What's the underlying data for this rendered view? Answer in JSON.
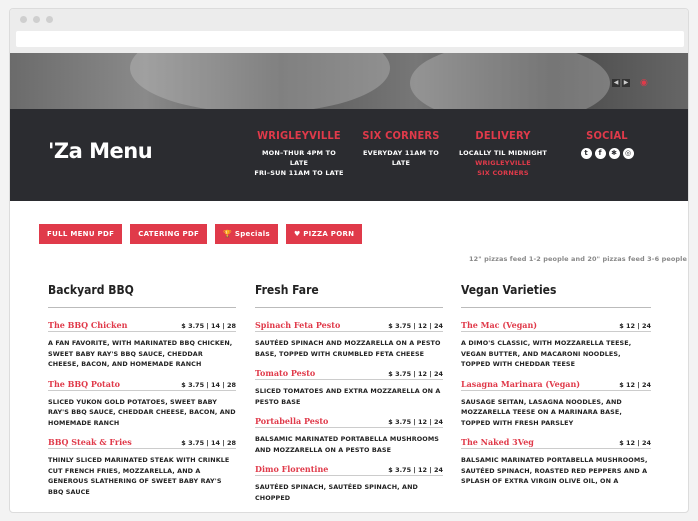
{
  "header": {
    "logo": "'Za Menu",
    "cols": [
      {
        "title": "WRIGLEYVILLE",
        "lines": [
          "MON–THUR 4PM TO LATE",
          "FRI–SUN 11AM TO LATE"
        ]
      },
      {
        "title": "SIX CORNERS",
        "lines": [
          "EVERYDAY 11AM TO LATE"
        ]
      },
      {
        "title": "DELIVERY",
        "lines": [
          "LOCALLY TIL MIDNIGHT"
        ],
        "links": [
          "WRIGLEYVILLE",
          "SIX CORNERS"
        ]
      },
      {
        "title": "SOCIAL"
      }
    ],
    "social_icons": [
      "twitter-icon",
      "facebook-icon",
      "yelp-icon",
      "instagram-icon"
    ]
  },
  "buttons": {
    "full_menu": "FULL MENU PDF",
    "catering": "CATERING PDF",
    "specials": "Specials",
    "pizza_porn": "PIZZA PORN"
  },
  "note": "12\" pizzas feed 1-2 people and 20\" pizzas feed 3-6 people",
  "columns": [
    {
      "title": "Backyard BBQ",
      "items": [
        {
          "name": "The BBQ Chicken",
          "price": "$ 3.75 | 14 | 28",
          "desc": "A FAN FAVORITE, WITH MARINATED BBQ CHICKEN, SWEET BABY RAY'S BBQ SAUCE, CHEDDAR CHEESE, BACON, AND HOMEMADE RANCH"
        },
        {
          "name": "The BBQ Potato",
          "price": "$ 3.75 | 14 | 28",
          "desc": "SLICED YUKON GOLD POTATOES, SWEET BABY RAY'S BBQ SAUCE, CHEDDAR CHEESE, BACON, AND HOMEMADE RANCH"
        },
        {
          "name": "BBQ Steak & Fries",
          "price": "$ 3.75 | 14 | 28",
          "desc": "THINLY SLICED MARINATED STEAK WITH CRINKLE CUT FRENCH FRIES, MOZZARELLA, AND A GENEROUS SLATHERING OF SWEET BABY RAY'S BBQ SAUCE"
        }
      ]
    },
    {
      "title": "Fresh Fare",
      "items": [
        {
          "name": "Spinach Feta Pesto",
          "price": "$ 3.75 | 12 | 24",
          "desc": "SAUTÉED SPINACH AND MOZZARELLA ON A PESTO BASE, TOPPED WITH CRUMBLED FETA CHEESE"
        },
        {
          "name": "Tomato Pesto",
          "price": "$ 3.75 | 12 | 24",
          "desc": "SLICED TOMATOES AND EXTRA MOZZARELLA ON A PESTO BASE"
        },
        {
          "name": "Portabella Pesto",
          "price": "$ 3.75 | 12 | 24",
          "desc": "BALSAMIC MARINATED PORTABELLA MUSHROOMS AND MOZZARELLA ON A PESTO BASE"
        },
        {
          "name": "Dimo Florentine",
          "price": "$ 3.75 | 12 | 24",
          "desc": "SAUTÉED SPINACH, SAUTÉED SPINACH, AND CHOPPED"
        }
      ]
    },
    {
      "title": "Vegan Varieties",
      "items": [
        {
          "name": "The Mac (Vegan)",
          "price": "$ 12 | 24",
          "desc": "A DIMO'S CLASSIC, WITH MOZZARELLA TEESE, VEGAN BUTTER, AND MACARONI NOODLES, TOPPED WITH CHEDDAR TEESE"
        },
        {
          "name": "Lasagna Marinara (Vegan)",
          "price": "$ 12 | 24",
          "desc": "SAUSAGE SEITAN, LASAGNA NOODLES, AND MOZZARELLA TEESE ON A MARINARA BASE, TOPPED WITH FRESH PARSLEY"
        },
        {
          "name": "The Naked 3Veg",
          "price": "$ 12 | 24",
          "desc": "BALSAMIC MARINATED PORTABELLA MUSHROOMS, SAUTÉED SPINACH, ROASTED RED PEPPERS AND A SPLASH OF EXTRA VIRGIN OLIVE OIL, ON A"
        }
      ]
    }
  ]
}
